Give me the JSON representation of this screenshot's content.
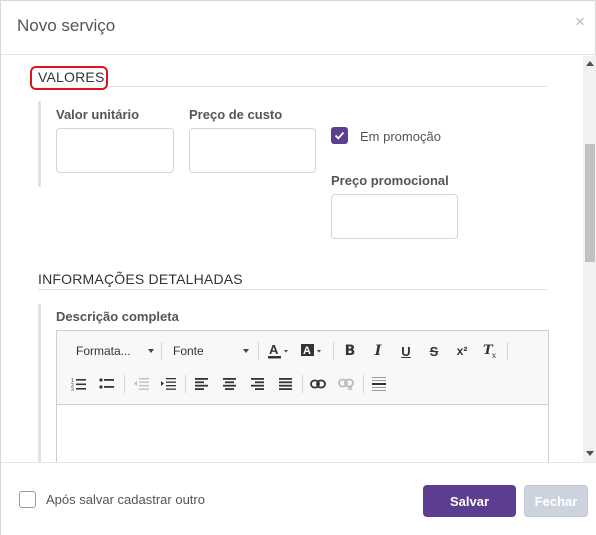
{
  "dialog": {
    "title": "Novo serviço",
    "close_glyph": "×"
  },
  "sections": {
    "valores": {
      "title": "VALORES"
    },
    "detalhes": {
      "title": "INFORMAÇÕES DETALHADAS"
    }
  },
  "fields": {
    "valor_unitario": {
      "label": "Valor unitário",
      "value": ""
    },
    "preco_custo": {
      "label": "Preço de custo",
      "value": ""
    },
    "em_promocao": {
      "label": "Em promoção",
      "checked": true
    },
    "preco_promocional": {
      "label": "Preço promocional",
      "value": ""
    },
    "descricao": {
      "label": "Descrição completa"
    }
  },
  "editor": {
    "format_combo": "Formata...",
    "font_combo": "Fonte",
    "text_color_icon": "text-color-icon",
    "bg_color_icon": "background-color-icon",
    "bold": "B",
    "italic": "I",
    "underline": "U",
    "strike": "S",
    "superscript": "x²",
    "remove_format": "Tx"
  },
  "footer": {
    "after_save_label": "Após salvar cadastrar outro",
    "save_label": "Salvar",
    "close_label": "Fechar"
  },
  "colors": {
    "primary": "#5c3d8f",
    "highlight": "#e0121f",
    "disabled": "#ccd3de"
  }
}
